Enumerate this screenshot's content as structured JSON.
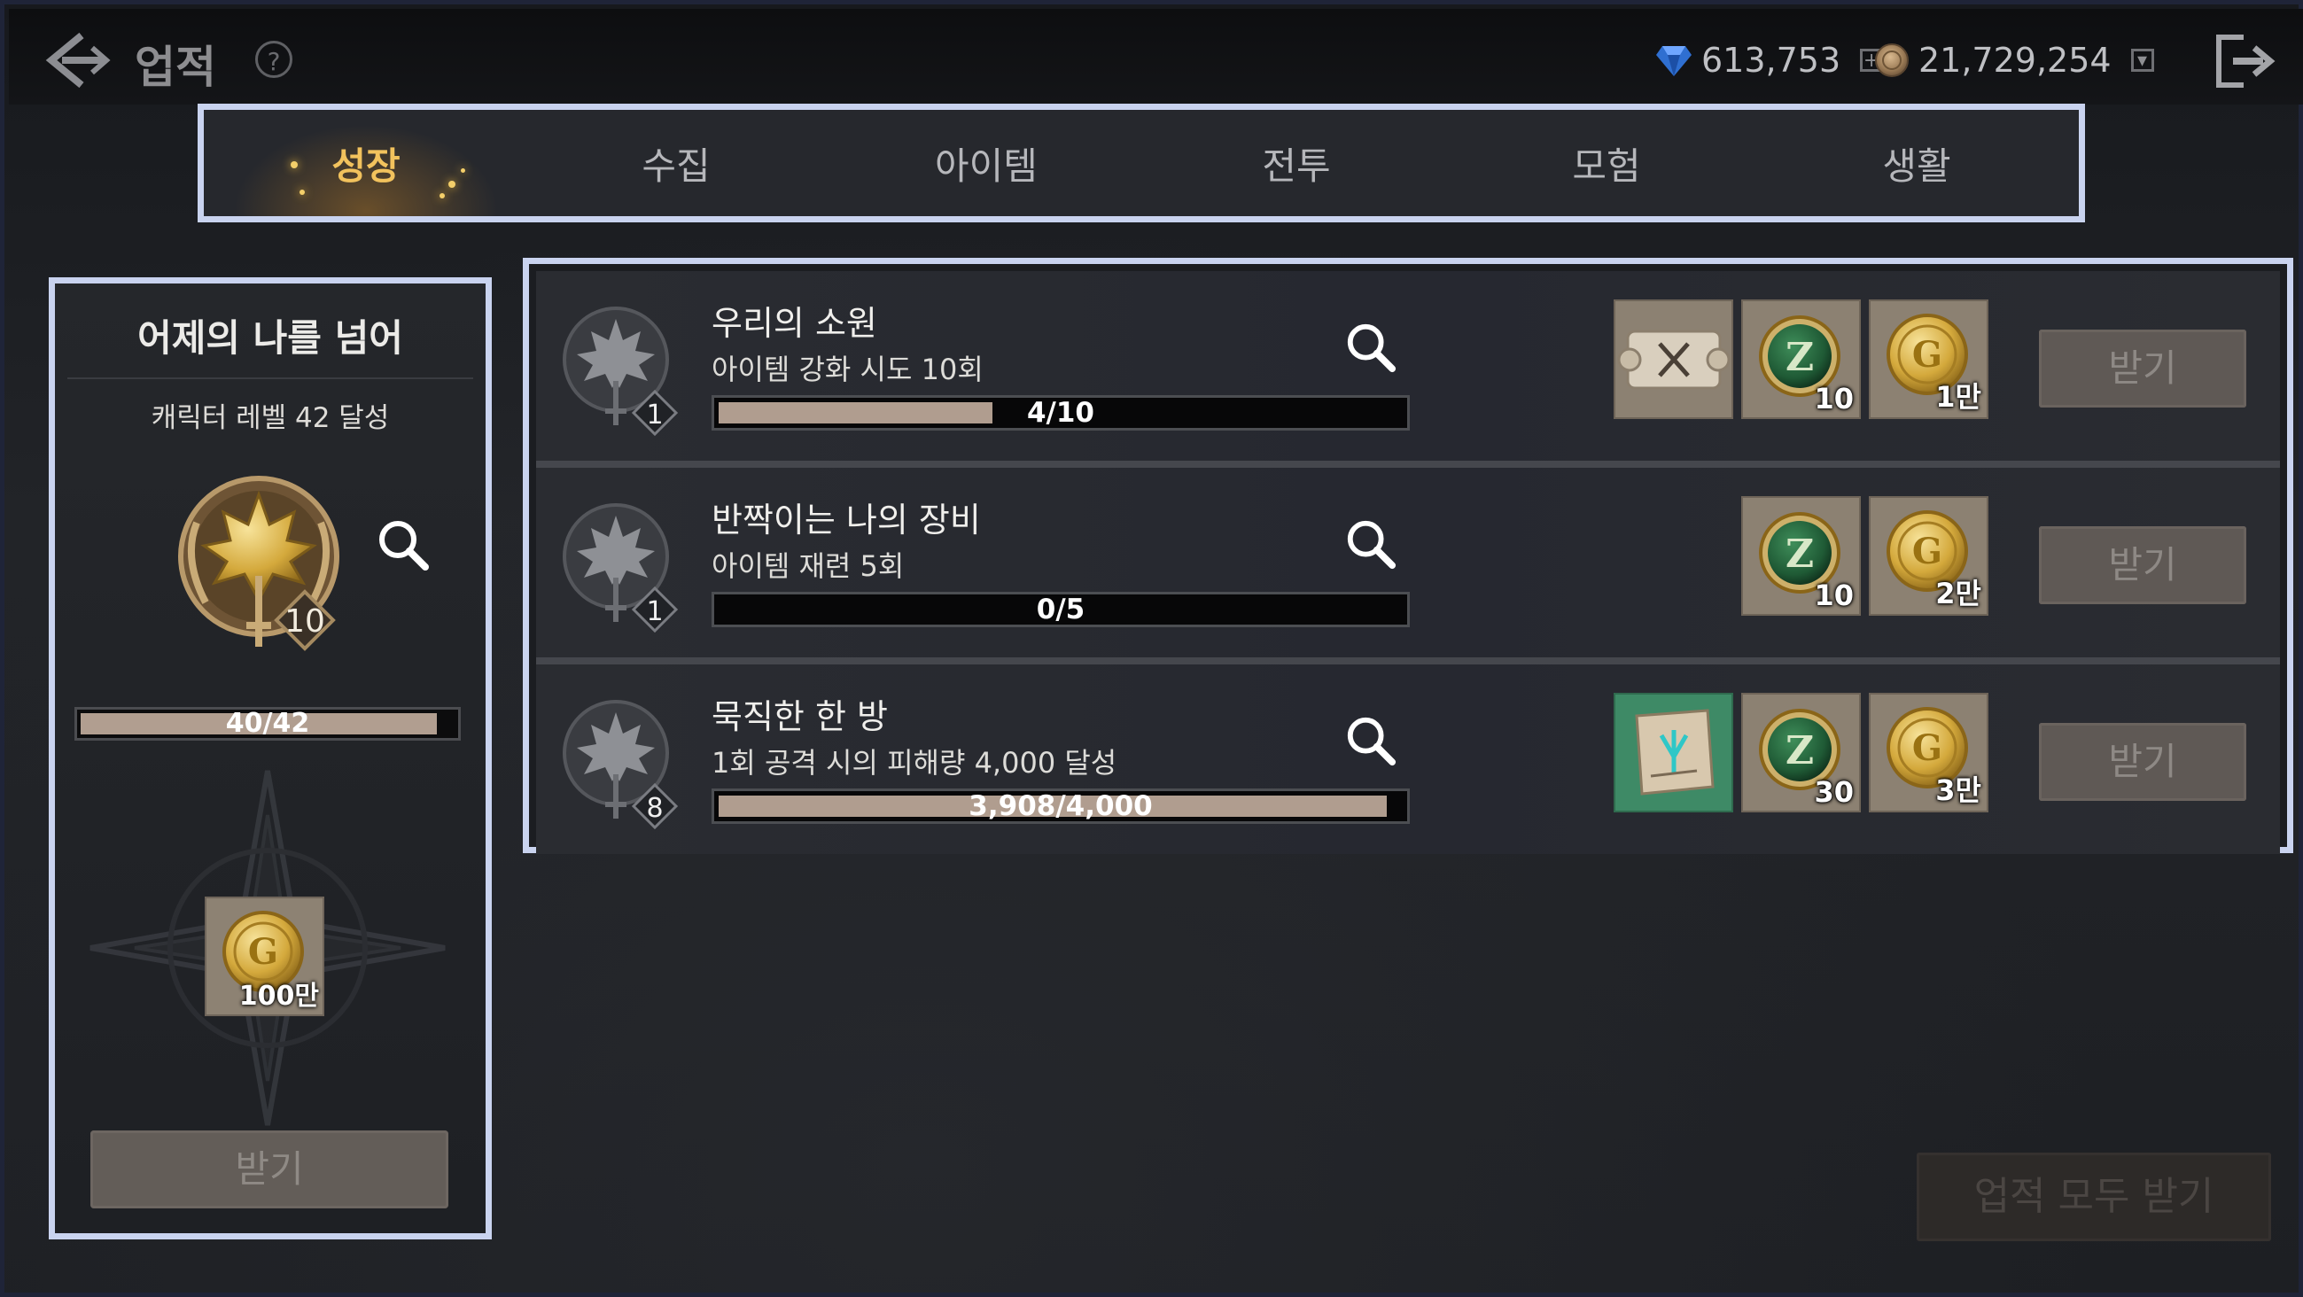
{
  "header": {
    "title": "업적",
    "currencies": {
      "gems": "613,753",
      "gold": "21,729,254"
    }
  },
  "tabs": [
    {
      "label": "성장",
      "active": true
    },
    {
      "label": "수집",
      "active": false
    },
    {
      "label": "아이템",
      "active": false
    },
    {
      "label": "전투",
      "active": false
    },
    {
      "label": "모험",
      "active": false
    },
    {
      "label": "생활",
      "active": false
    }
  ],
  "summary": {
    "title": "어제의 나를 넘어",
    "condition": "캐릭터 레벨 42 달성",
    "tier": "10",
    "progress_text": "40/42",
    "progress": 0.952,
    "reward": {
      "icon": "gold-coin-icon",
      "count": "100만"
    },
    "claim_label": "받기"
  },
  "achievements": [
    {
      "name": "우리의 소원",
      "desc": "아이템 강화 시도 10회",
      "tier": "1",
      "progress_text": "4/10",
      "progress": 0.4,
      "rewards": [
        {
          "icon": "scroll-map-icon",
          "count": ""
        },
        {
          "icon": "z-coin-icon",
          "count": "10"
        },
        {
          "icon": "gold-coin-icon",
          "count": "1만"
        }
      ],
      "claim_label": "받기"
    },
    {
      "name": "반짝이는 나의 장비",
      "desc": "아이템 재련 5회",
      "tier": "1",
      "progress_text": "0/5",
      "progress": 0,
      "rewards": [
        {
          "icon": "z-coin-icon",
          "count": "10"
        },
        {
          "icon": "gold-coin-icon",
          "count": "2만"
        }
      ],
      "claim_label": "받기"
    },
    {
      "name": "묵직한 한 방",
      "desc": "1회 공격 시의 피해량 4,000 달성",
      "tier": "8",
      "progress_text": "3,908/4,000",
      "progress": 0.977,
      "rewards": [
        {
          "icon": "enchant-scroll-icon",
          "count": ""
        },
        {
          "icon": "z-coin-icon",
          "count": "30"
        },
        {
          "icon": "gold-coin-icon",
          "count": "3만"
        }
      ],
      "claim_label": "받기"
    }
  ],
  "claim_all_label": "업적 모두 받기",
  "colors": {
    "accent": "#f2c25d",
    "highlight_border": "#c9d3ef",
    "progress_fill": "#b09d8f"
  }
}
